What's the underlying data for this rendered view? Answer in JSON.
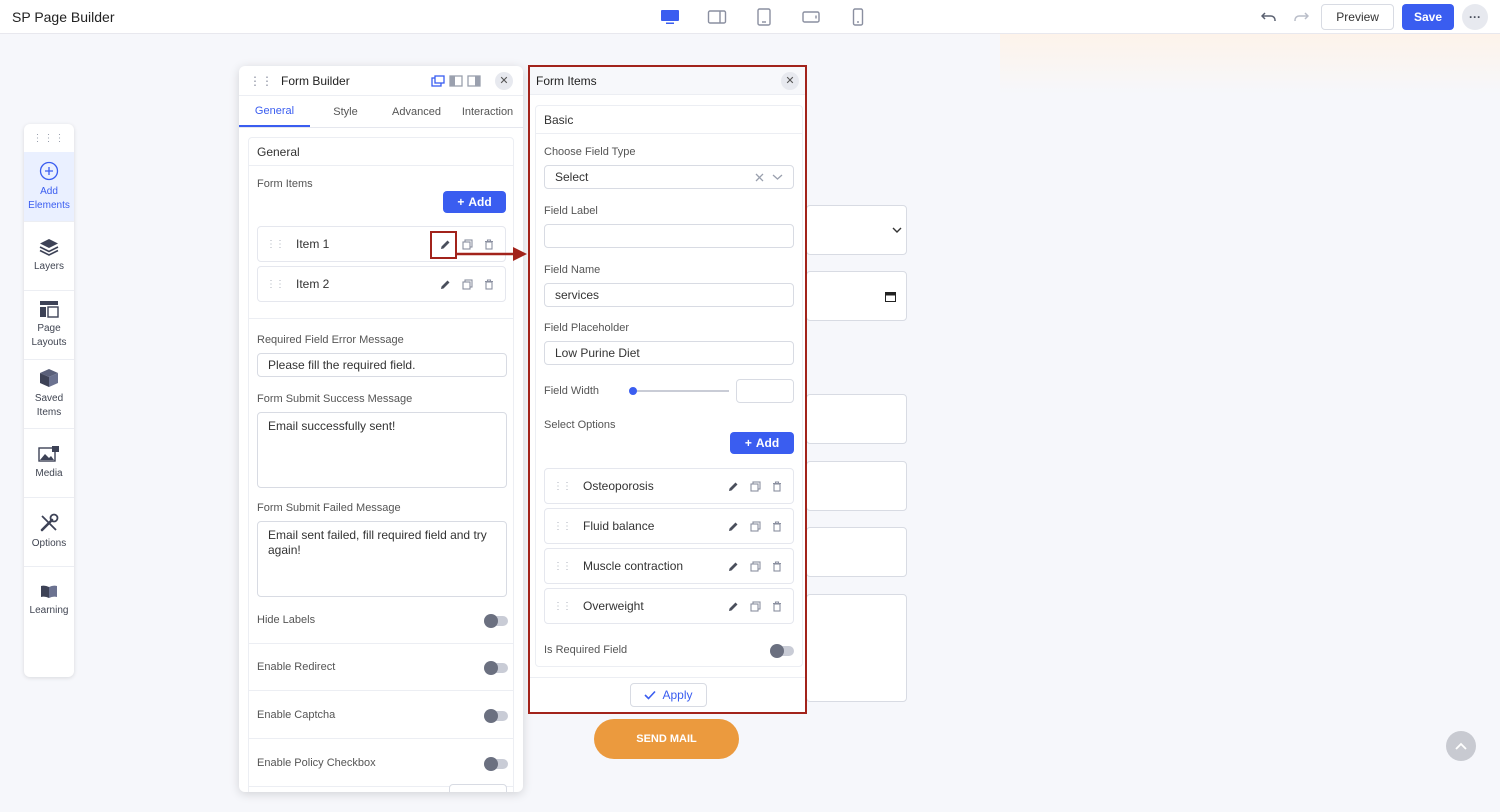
{
  "app": {
    "title": "SP Page Builder",
    "preview_label": "Preview",
    "save_label": "Save"
  },
  "sidebar": {
    "items": [
      {
        "label": "Add Elements",
        "icon": "plus-circle-icon",
        "active": true
      },
      {
        "label": "Layers",
        "icon": "layers-icon"
      },
      {
        "label": "Page Layouts",
        "icon": "layout-icon"
      },
      {
        "label": "Saved Items",
        "icon": "box-icon"
      },
      {
        "label": "Media",
        "icon": "image-icon"
      },
      {
        "label": "Options",
        "icon": "tools-icon"
      },
      {
        "label": "Learning",
        "icon": "book-icon"
      }
    ]
  },
  "form_builder": {
    "title": "Form Builder",
    "tabs": [
      "General",
      "Style",
      "Advanced",
      "Interaction"
    ],
    "section_title": "General",
    "form_items_label": "Form Items",
    "add_label": "Add",
    "items": [
      "Item 1",
      "Item 2"
    ],
    "required_error_label": "Required Field Error Message",
    "required_error_value": "Please fill the required field.",
    "success_label": "Form Submit Success Message",
    "success_value": "Email successfully sent!",
    "failed_label": "Form Submit Failed Message",
    "failed_value": "Email sent failed, fill required field and try again!",
    "toggles": [
      "Hide Labels",
      "Enable Redirect",
      "Enable Captcha",
      "Enable Policy Checkbox"
    ]
  },
  "form_items": {
    "title": "Form Items",
    "section_title": "Basic",
    "field_type_label": "Choose Field Type",
    "field_type_value": "Select",
    "field_label_label": "Field Label",
    "field_label_value": "",
    "field_name_label": "Field Name",
    "field_name_value": "services",
    "field_placeholder_label": "Field Placeholder",
    "field_placeholder_value": "Low Purine Diet",
    "field_width_label": "Field Width",
    "field_width_value": "",
    "select_options_label": "Select Options",
    "add_label": "Add",
    "options": [
      "Osteoporosis",
      "Fluid balance",
      "Muscle contraction",
      "Overweight"
    ],
    "required_label": "Is Required Field",
    "apply_label": "Apply"
  },
  "canvas": {
    "send_label": "SEND MAIL"
  },
  "colors": {
    "accent": "#3a5df0",
    "highlight": "#a2231b",
    "send_button": "#eb9a3e"
  }
}
